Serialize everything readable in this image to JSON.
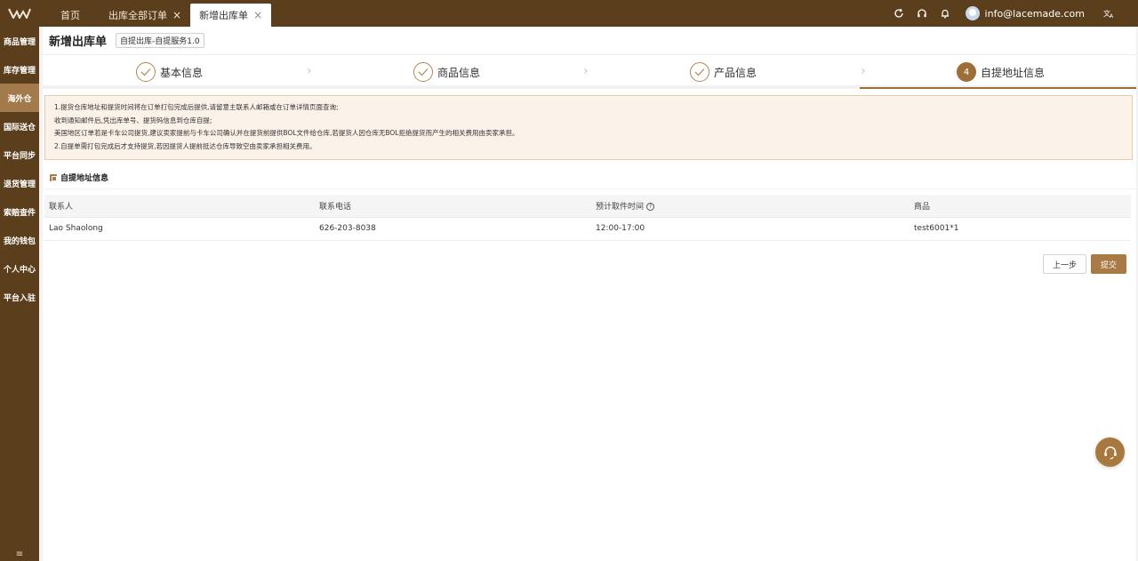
{
  "colors": {
    "brand_dark": "#5b3f1d",
    "accent": "#a27a4b",
    "submit": "#a97a45"
  },
  "topbar": {
    "tabs": [
      {
        "label": "首页",
        "closable": false,
        "active": false
      },
      {
        "label": "出库全部订单",
        "closable": true,
        "active": false
      },
      {
        "label": "新增出库单",
        "closable": true,
        "active": true
      }
    ],
    "close_glyph": "×",
    "tools": [
      "refresh-icon",
      "headset-icon",
      "bell-icon"
    ],
    "user_email": "info@lacemade.com",
    "lang_icon": "translate-icon"
  },
  "sidebar": {
    "items": [
      {
        "label": "商品管理"
      },
      {
        "label": "库存管理"
      },
      {
        "label": "海外仓",
        "active": true
      },
      {
        "label": "国际送仓"
      },
      {
        "label": "平台同步"
      },
      {
        "label": "退货管理"
      },
      {
        "label": "索赔查件"
      },
      {
        "label": "我的钱包"
      },
      {
        "label": "个人中心"
      },
      {
        "label": "平台入驻"
      }
    ],
    "collapse_glyph": "≡"
  },
  "page": {
    "title": "新增出库单",
    "service_tag": "自提出库-自提服务1.0"
  },
  "steps": [
    {
      "label": "基本信息",
      "status": "done"
    },
    {
      "label": "商品信息",
      "status": "done"
    },
    {
      "label": "产品信息",
      "status": "done"
    },
    {
      "label": "自提地址信息",
      "status": "current",
      "number": "4"
    }
  ],
  "notice": {
    "lines": [
      "1.提货仓库地址和提货时间将在订单打包完成后提供,请留意主联系人邮箱或在订单详情页面查询;",
      "收到通知邮件后,凭出库单号、提货码信息到仓库自提;",
      "美国地区订单若是卡车公司提货,建议卖家提前与卡车公司确认并在提货前提供BOL文件给仓库,若提货人因仓库无BOL拒绝提货而产生的相关费用由卖家承担。",
      "2.自提单需打包完成后才支持提货,若因提货人提前抵达仓库导致空由卖家承担相关费用。"
    ]
  },
  "section": {
    "title": "自提地址信息"
  },
  "table": {
    "headers": [
      "联系人",
      "联系电话",
      "预计取件时间",
      "商品"
    ],
    "help_glyph": "?",
    "rows": [
      [
        "Lao Shaolong",
        "626-203-8038",
        "12:00-17:00",
        "test6001*1"
      ]
    ]
  },
  "buttons": {
    "prev": "上一步",
    "submit": "提交"
  }
}
